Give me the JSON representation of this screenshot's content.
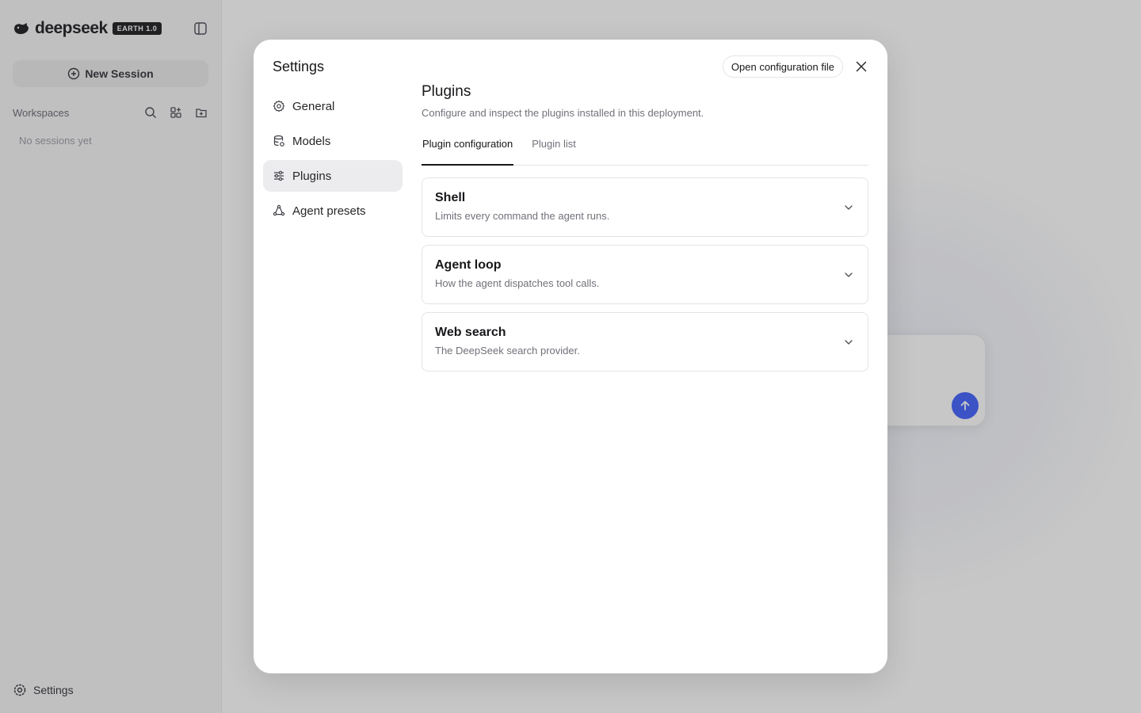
{
  "background": {
    "brand_name": "deepseek",
    "brand_badge": "EARTH 1.0",
    "new_session_label": "New Session",
    "workspaces_label": "Workspaces",
    "empty_sessions": "No sessions yet",
    "settings_label": "Settings",
    "accent_color": "#4d6bfe"
  },
  "modal": {
    "title": "Settings",
    "nav": [
      {
        "label": "General",
        "icon": "gear-icon"
      },
      {
        "label": "Models",
        "icon": "database-icon"
      },
      {
        "label": "Plugins",
        "icon": "sliders-icon",
        "active": true
      },
      {
        "label": "Agent presets",
        "icon": "agent-cycle-icon"
      }
    ],
    "open_config_label": "Open configuration file",
    "section": {
      "title": "Plugins",
      "description": "Configure and inspect the plugins installed in this deployment."
    },
    "tabs": [
      {
        "label": "Plugin configuration",
        "active": true
      },
      {
        "label": "Plugin list",
        "active": false
      }
    ],
    "cards": [
      {
        "title": "Shell",
        "description": "Limits every command the agent runs."
      },
      {
        "title": "Agent loop",
        "description": "How the agent dispatches tool calls."
      },
      {
        "title": "Web search",
        "description": "The DeepSeek search provider."
      }
    ]
  }
}
